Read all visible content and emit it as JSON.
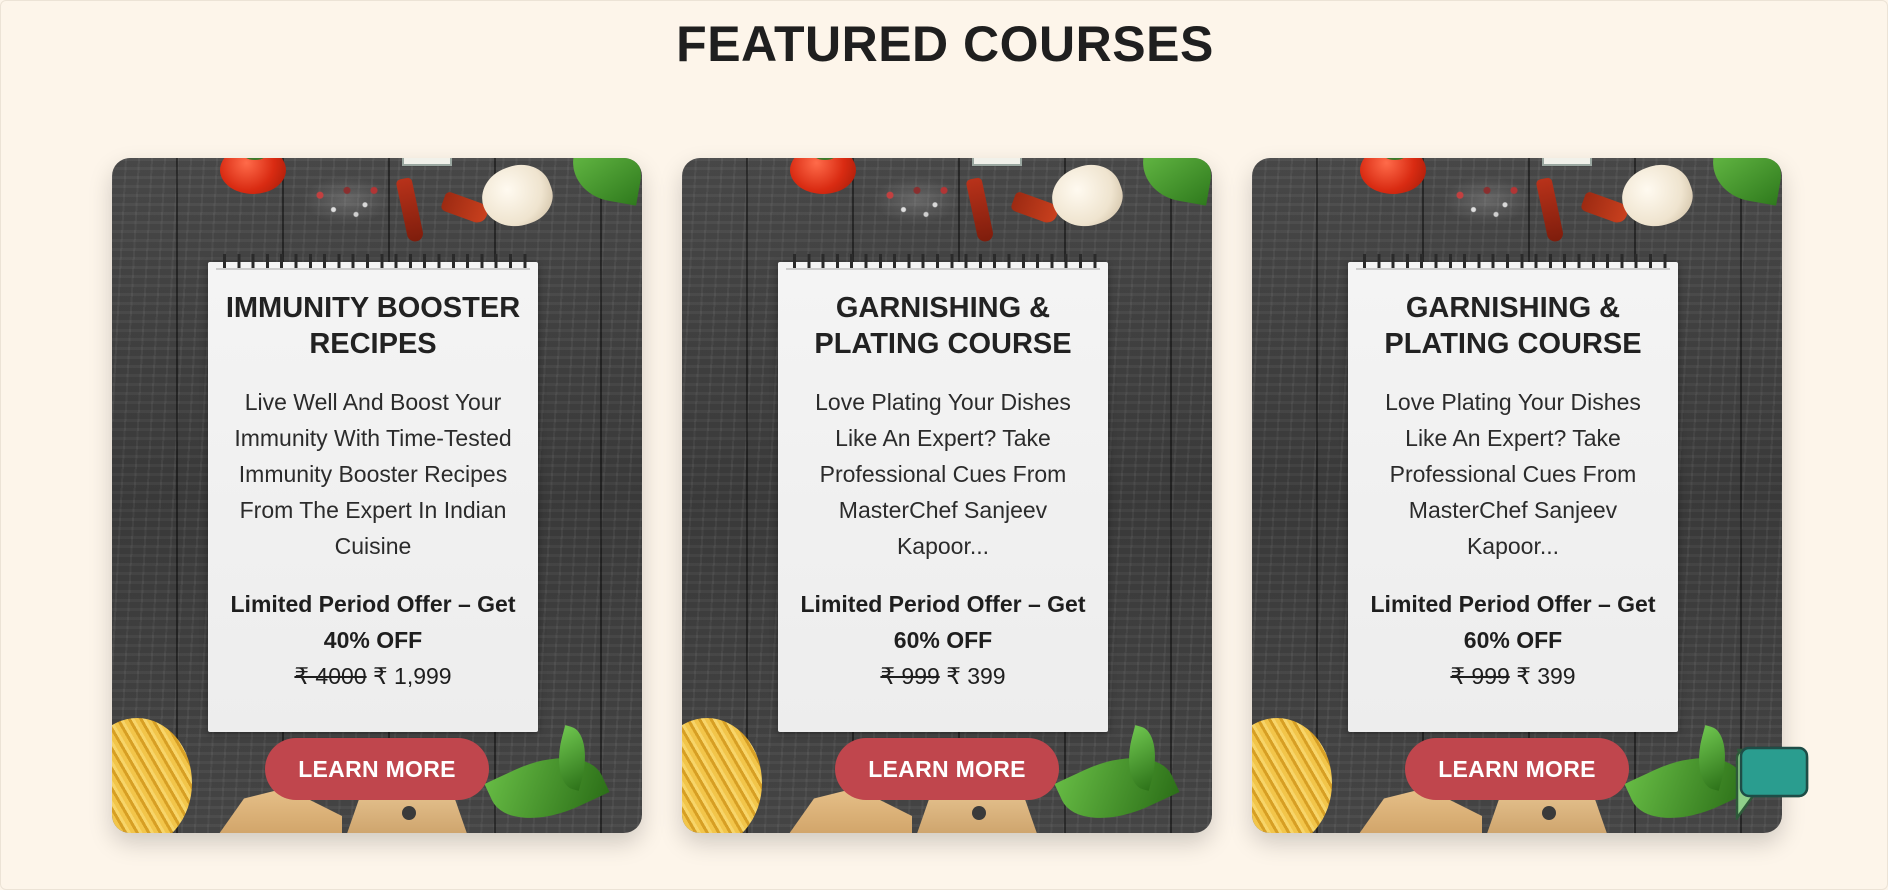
{
  "section": {
    "title": "FEATURED COURSES"
  },
  "cards": [
    {
      "title": "IMMUNITY BOOSTER RECIPES",
      "description": "Live Well And Boost Your Immunity With Time-Tested Immunity Booster Recipes From The Expert In Indian Cuisine",
      "offer": "Limited Period Offer – Get 40% OFF",
      "old_price": "₹ 4000",
      "new_price": "₹ 1,999",
      "button_label": "LEARN MORE"
    },
    {
      "title": "GARNISHING & PLATING COURSE",
      "description": "Love Plating Your Dishes Like An Expert? Take Professional Cues From MasterChef Sanjeev Kapoor...",
      "offer": "Limited Period Offer – Get 60% OFF",
      "old_price": "₹ 999",
      "new_price": "₹ 399",
      "button_label": "LEARN MORE"
    },
    {
      "title": "GARNISHING & PLATING COURSE",
      "description": "Love Plating Your Dishes Like An Expert? Take Professional Cues From MasterChef Sanjeev Kapoor...",
      "offer": "Limited Period Offer – Get 60% OFF",
      "old_price": "₹ 999",
      "new_price": "₹ 399",
      "button_label": "LEARN MORE"
    }
  ],
  "chat_widget": {
    "icon": "chat-bubbles-icon"
  },
  "colors": {
    "background": "#fdf5ea",
    "button": "#c0464d",
    "chat_front": "#2a9d8f",
    "chat_back": "#8fd18a"
  }
}
